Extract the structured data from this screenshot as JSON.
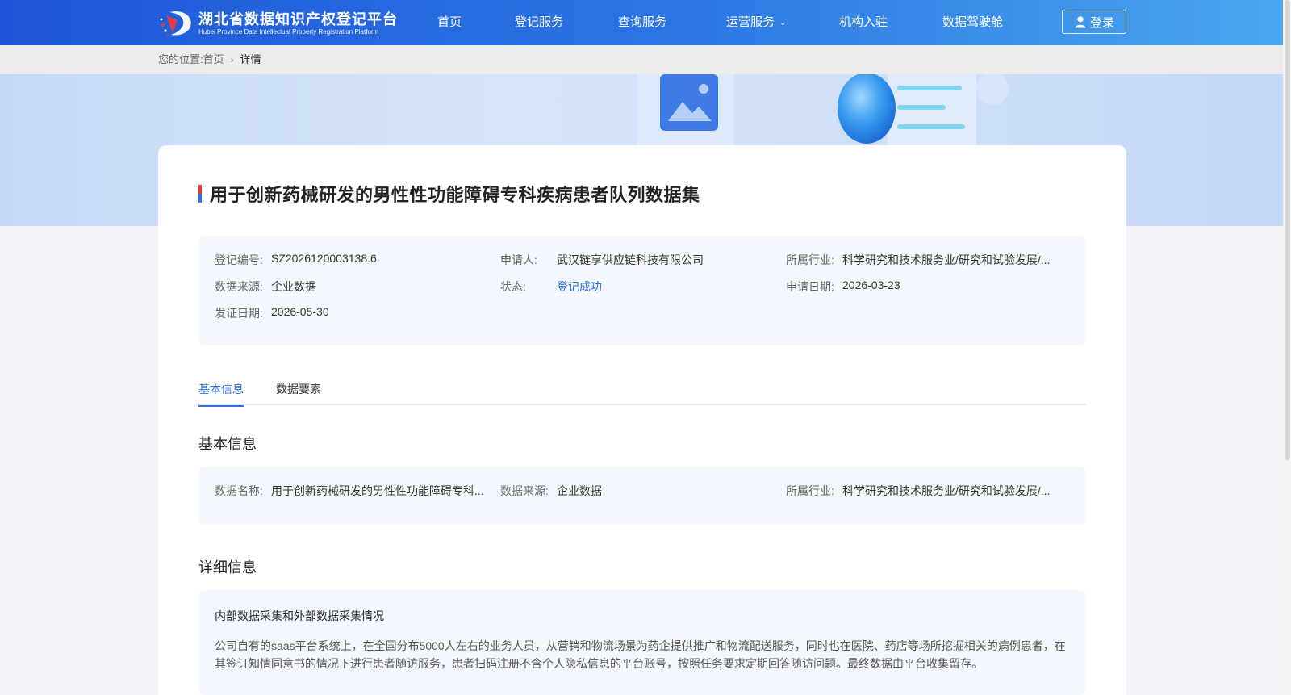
{
  "header": {
    "logo_cn": "湖北省数据知识产权登记平台",
    "logo_en": "Hubei Province Data Intellectual Property Registration Platform",
    "nav": [
      "首页",
      "登记服务",
      "查询服务",
      "运营服务",
      "机构入驻",
      "数据驾驶舱"
    ],
    "login_label": "登录",
    "colors": {
      "header_start": "#1d56d8",
      "header_end": "#4aa6ee"
    }
  },
  "breadcrumb": {
    "label": "您的位置:",
    "home": "首页",
    "current": "详情"
  },
  "dataset": {
    "title": "用于创新药械研发的男性性功能障碍专科疾病患者队列数据集"
  },
  "summary": {
    "reg_no": {
      "label": "登记编号:",
      "value": "SZ2026120003138.6"
    },
    "applicant": {
      "label": "申请人:",
      "value": "武汉链享供应链科技有限公司"
    },
    "industry": {
      "label": "所属行业:",
      "value": "科学研究和技术服务业/研究和试验发展/..."
    },
    "source": {
      "label": "数据来源:",
      "value": "企业数据"
    },
    "status": {
      "label": "状态:",
      "value": "登记成功"
    },
    "apply_date": {
      "label": "申请日期:",
      "value": "2026-03-23"
    },
    "issue_date": {
      "label": "发证日期:",
      "value": "2026-05-30"
    }
  },
  "tabs": [
    {
      "label": "基本信息",
      "active": true
    },
    {
      "label": "数据要素",
      "active": false
    }
  ],
  "basic": {
    "section_title": "基本信息",
    "name": {
      "label": "数据名称:",
      "value": "用于创新药械研发的男性性功能障碍专科..."
    },
    "source": {
      "label": "数据来源:",
      "value": "企业数据"
    },
    "industry": {
      "label": "所属行业:",
      "value": "科学研究和技术服务业/研究和试验发展/..."
    }
  },
  "detail": {
    "section_title": "详细信息",
    "heading": "内部数据采集和外部数据采集情况",
    "body": "公司自有的saas平台系统上，在全国分布5000人左右的业务人员，从营销和物流场景为药企提供推广和物流配送服务，同时也在医院、药店等场所挖掘相关的病例患者，在其签订知情同意书的情况下进行患者随访服务，患者扫码注册不含个人隐私信息的平台账号，按照任务要求定期回答随访问题。最终数据由平台收集留存。"
  }
}
